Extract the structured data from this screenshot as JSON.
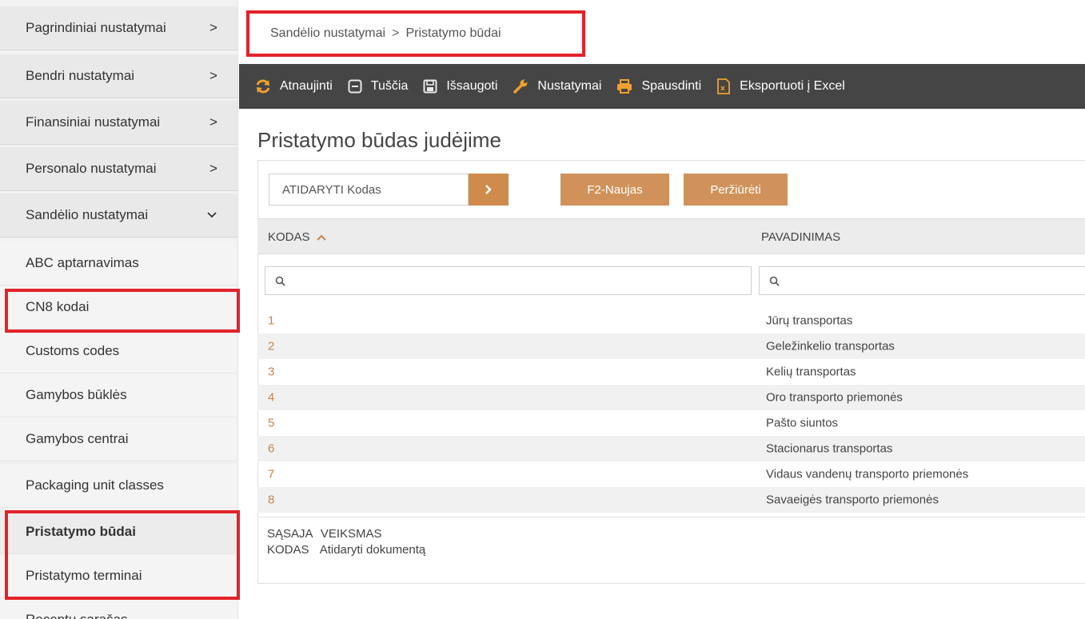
{
  "sidebar": {
    "items": [
      {
        "label": "Pagrindiniai nustatymai",
        "arrow": ">"
      },
      {
        "label": "Bendri nustatymai",
        "arrow": ">"
      },
      {
        "label": "Finansiniai nustatymai",
        "arrow": ">"
      },
      {
        "label": "Personalo nustatymai",
        "arrow": ">"
      },
      {
        "label": "Sandėlio nustatymai"
      }
    ],
    "subitems": [
      {
        "label": "ABC aptarnavimas"
      },
      {
        "label": "CN8 kodai"
      },
      {
        "label": "Customs codes"
      },
      {
        "label": "Gamybos būklės"
      },
      {
        "label": "Gamybos centrai"
      },
      {
        "label": "Packaging unit classes"
      },
      {
        "label": "Pristatymo būdai"
      },
      {
        "label": "Pristatymo terminai"
      },
      {
        "label": "Receptų sąrašas"
      }
    ]
  },
  "breadcrumb": {
    "parent": "Sandėlio nustatymai",
    "separator": ">",
    "current": "Pristatymo būdai"
  },
  "toolbar": {
    "refresh": "Atnaujinti",
    "empty": "Tuščia",
    "save": "Išsaugoti",
    "settings": "Nustatymai",
    "print": "Spausdinti",
    "export": "Eksportuoti į Excel"
  },
  "main": {
    "title": "Pristatymo būdas judėjime",
    "open_placeholder": "ATIDARYTI Kodas",
    "new_button": "F2-Naujas",
    "view_button": "Peržiūrėti"
  },
  "table": {
    "columns": [
      "KODAS",
      "PAVADINIMAS"
    ],
    "rows": [
      {
        "code": "1",
        "name": "Jūrų transportas"
      },
      {
        "code": "2",
        "name": "Geležinkelio transportas"
      },
      {
        "code": "3",
        "name": "Kelių transportas"
      },
      {
        "code": "4",
        "name": "Oro transporto priemonės"
      },
      {
        "code": "5",
        "name": "Pašto siuntos"
      },
      {
        "code": "6",
        "name": "Stacionarus transportas"
      },
      {
        "code": "7",
        "name": "Vidaus vandenų transporto priemonės"
      },
      {
        "code": "8",
        "name": "Savaeigės transporto priemonės"
      }
    ]
  },
  "legend": {
    "header_left": "SĄSAJA",
    "header_right": "VEIKSMAS",
    "row_left": "KODAS",
    "row_right": "Atidaryti dokumentą"
  },
  "colors": {
    "accent": "#c7844a",
    "toolbar_bg": "#454545",
    "highlight": "#e32229"
  }
}
